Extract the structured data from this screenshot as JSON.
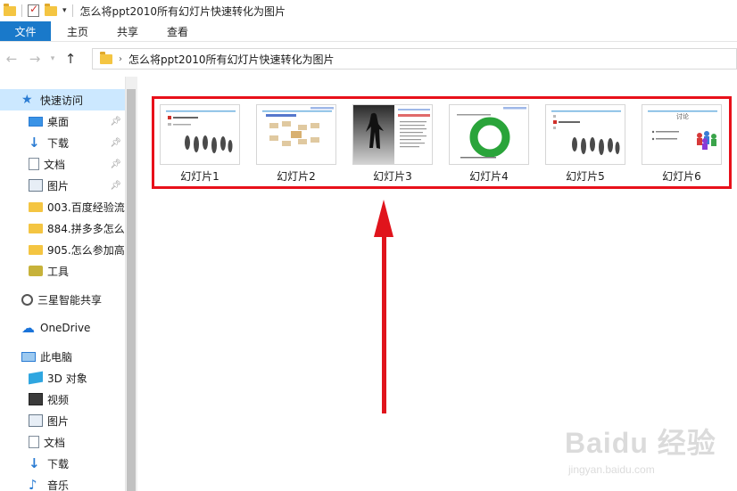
{
  "window": {
    "title": "怎么将ppt2010所有幻灯片快速转化为图片"
  },
  "ribbon": {
    "tabs": [
      "文件",
      "主页",
      "共享",
      "查看"
    ]
  },
  "address": {
    "path": "怎么将ppt2010所有幻灯片快速转化为图片"
  },
  "sidebar": {
    "items": [
      {
        "label": "快速访问",
        "icon": "star-icon"
      },
      {
        "label": "桌面",
        "icon": "desktop-icon",
        "pinned": true
      },
      {
        "label": "下载",
        "icon": "download-icon",
        "pinned": true
      },
      {
        "label": "文档",
        "icon": "document-icon",
        "pinned": true
      },
      {
        "label": "图片",
        "icon": "pictures-icon",
        "pinned": true
      },
      {
        "label": "003.百度经验流:",
        "icon": "folder-icon"
      },
      {
        "label": "884.拼多多怎么:",
        "icon": "folder-icon"
      },
      {
        "label": "905.怎么参加高:",
        "icon": "folder-icon"
      },
      {
        "label": "工具",
        "icon": "tools-folder-icon"
      },
      {
        "label": "三星智能共享",
        "icon": "samsung-share-icon"
      },
      {
        "label": "OneDrive",
        "icon": "onedrive-cloud-icon"
      },
      {
        "label": "此电脑",
        "icon": "this-pc-icon"
      },
      {
        "label": "3D 对象",
        "icon": "3d-objects-icon"
      },
      {
        "label": "视频",
        "icon": "videos-icon"
      },
      {
        "label": "图片",
        "icon": "pictures-icon"
      },
      {
        "label": "文档",
        "icon": "document-icon"
      },
      {
        "label": "下载",
        "icon": "download-icon"
      },
      {
        "label": "音乐",
        "icon": "music-icon"
      }
    ]
  },
  "files": [
    {
      "label": "幻灯片1"
    },
    {
      "label": "幻灯片2"
    },
    {
      "label": "幻灯片3"
    },
    {
      "label": "幻灯片4"
    },
    {
      "label": "幻灯片5"
    },
    {
      "label": "幻灯片6"
    }
  ],
  "slide6_heading": "讨论",
  "watermark": {
    "brand": "Baidu 经验",
    "url": "jingyan.baidu.com"
  },
  "colors": {
    "accent": "#1979ca",
    "selection": "#cce8ff",
    "annotation_red": "#e8101a"
  }
}
